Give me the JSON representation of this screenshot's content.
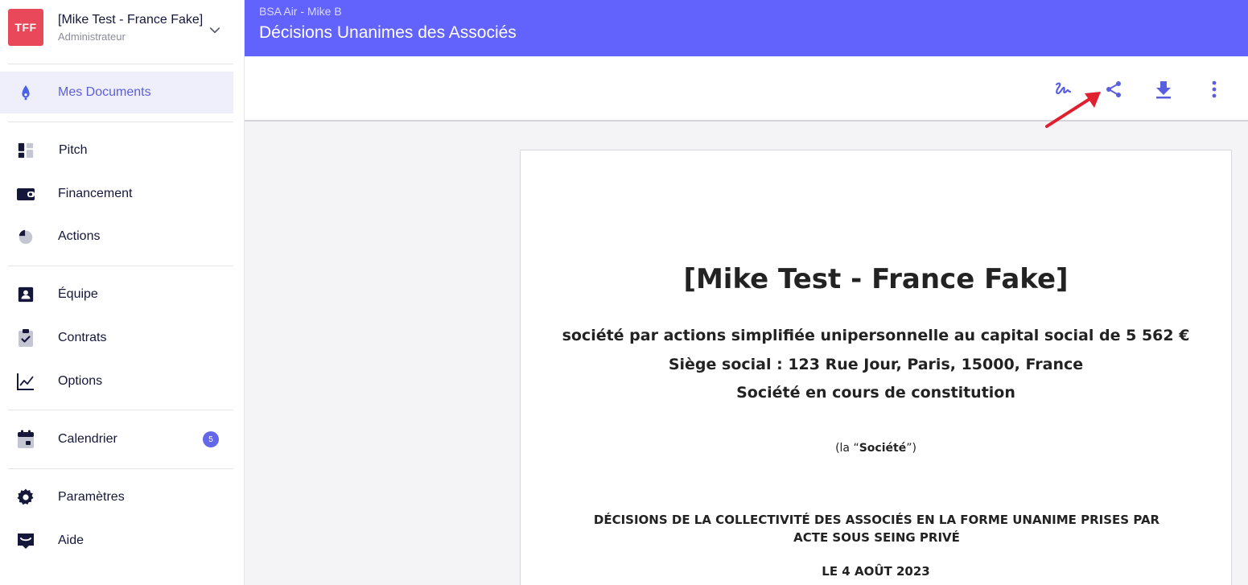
{
  "org": {
    "initials": "TFF",
    "name": "[Mike Test - France Fake]",
    "role": "Administrateur"
  },
  "sidebar": {
    "items": [
      {
        "label": "Mes Documents",
        "icon": "pen-nib-icon",
        "active": true
      },
      {
        "label": "Pitch",
        "icon": "dashboard-icon"
      },
      {
        "label": "Financement",
        "icon": "wallet-icon"
      },
      {
        "label": "Actions",
        "icon": "pie-chart-icon"
      },
      {
        "label": "Équipe",
        "icon": "person-card-icon"
      },
      {
        "label": "Contrats",
        "icon": "clipboard-check-icon"
      },
      {
        "label": "Options",
        "icon": "line-chart-icon"
      },
      {
        "label": "Calendrier",
        "icon": "calendar-icon",
        "badge": "5"
      },
      {
        "label": "Paramètres",
        "icon": "gear-icon"
      },
      {
        "label": "Aide",
        "icon": "chat-icon"
      }
    ]
  },
  "header": {
    "breadcrumb": "BSA Air - Mike B",
    "title": "Décisions Unanimes des Associés"
  },
  "toolbar": {
    "icons": [
      "signature-icon",
      "share-icon",
      "download-icon",
      "more-vertical-icon"
    ]
  },
  "colors": {
    "accent": "#6262fc",
    "avatar": "#e8485a",
    "badge": "#6367e8",
    "nav_dark": "#14163a",
    "annotation_arrow": "#e0202e"
  },
  "document": {
    "title": "[Mike Test - France Fake]",
    "line1": "société par actions simplifiée unipersonnelle au capital social de 5 562 €",
    "line2": "Siège social : 123 Rue Jour, Paris, 15000, France",
    "line3": "Société en cours de constitution",
    "society_prefix": "(la “",
    "society_bold": "Société",
    "society_suffix": "”)",
    "heading": "DÉCISIONS DE LA COLLECTIVITÉ DES ASSOCIÉS EN LA FORME UNANIME PRISES PAR ACTE SOUS SEING PRIVÉ",
    "date": "LE 4 AOÛT 2023"
  }
}
